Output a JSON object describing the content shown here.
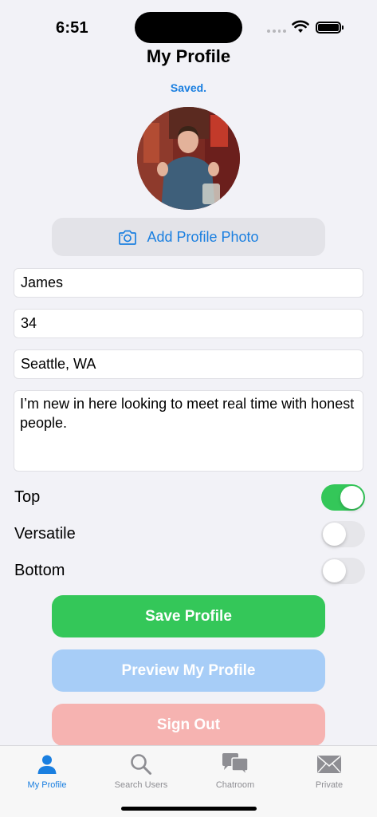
{
  "status": {
    "time": "6:51"
  },
  "header": {
    "title": "My Profile",
    "saved_text": "Saved."
  },
  "photo": {
    "add_label": "Add Profile Photo"
  },
  "form": {
    "name": "James",
    "age": "34",
    "location": "Seattle, WA",
    "bio": "I’m new in here looking to meet real time with honest people."
  },
  "roles": [
    {
      "label": "Top",
      "on": true
    },
    {
      "label": "Versatile",
      "on": false
    },
    {
      "label": "Bottom",
      "on": false
    }
  ],
  "buttons": {
    "save": "Save Profile",
    "preview": "Preview My Profile",
    "signout": "Sign Out"
  },
  "tabs": [
    {
      "label": "My Profile",
      "icon": "person-icon",
      "active": true
    },
    {
      "label": "Search Users",
      "icon": "search-icon",
      "active": false
    },
    {
      "label": "Chatroom",
      "icon": "chat-bubbles-icon",
      "active": false
    },
    {
      "label": "Private",
      "icon": "envelope-icon",
      "active": false
    }
  ],
  "colors": {
    "accent": "#1a7fe0",
    "save_button": "#34c759",
    "preview_button": "#a7cdf7",
    "signout_button": "#f6b3b1",
    "toggle_on": "#34c759"
  }
}
